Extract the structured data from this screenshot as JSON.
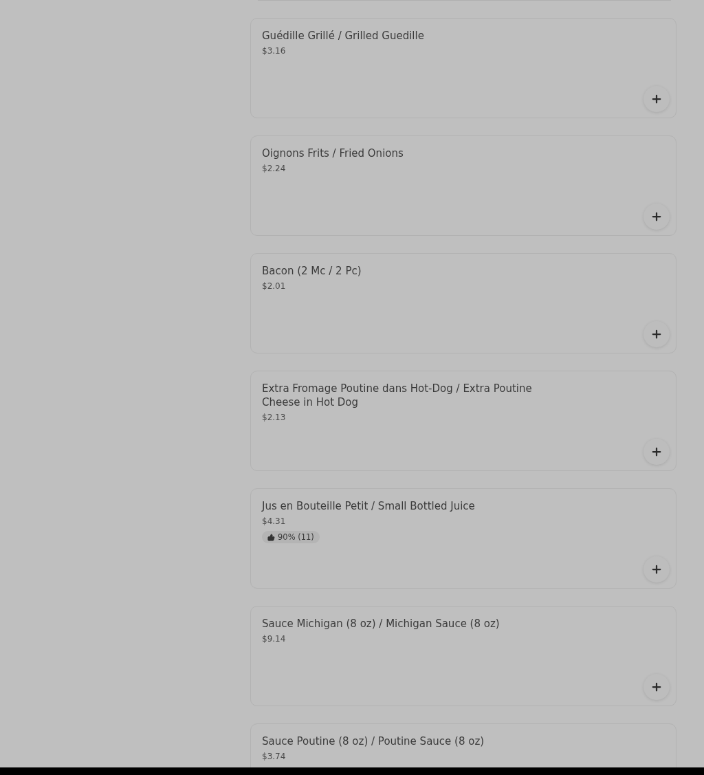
{
  "items": [
    {
      "name": "Guédille Grillé / Grilled Guedille",
      "price": "$3.16"
    },
    {
      "name": "Oignons Frits / Fried Onions",
      "price": "$2.24"
    },
    {
      "name": "Bacon (2 Mc / 2 Pc)",
      "price": "$2.01"
    },
    {
      "name": "Extra Fromage Poutine dans Hot-Dog / Extra Poutine Cheese in Hot Dog",
      "price": "$2.13"
    },
    {
      "name": "Jus en Bouteille Petit / Small Bottled Juice",
      "price": "$4.31",
      "rating": "90% (11)"
    },
    {
      "name": "Sauce Michigan (8 oz) / Michigan Sauce (8 oz)",
      "price": "$9.14"
    },
    {
      "name": "Sauce Poutine (8 oz) / Poutine Sauce (8 oz)",
      "price": "$3.74"
    }
  ]
}
